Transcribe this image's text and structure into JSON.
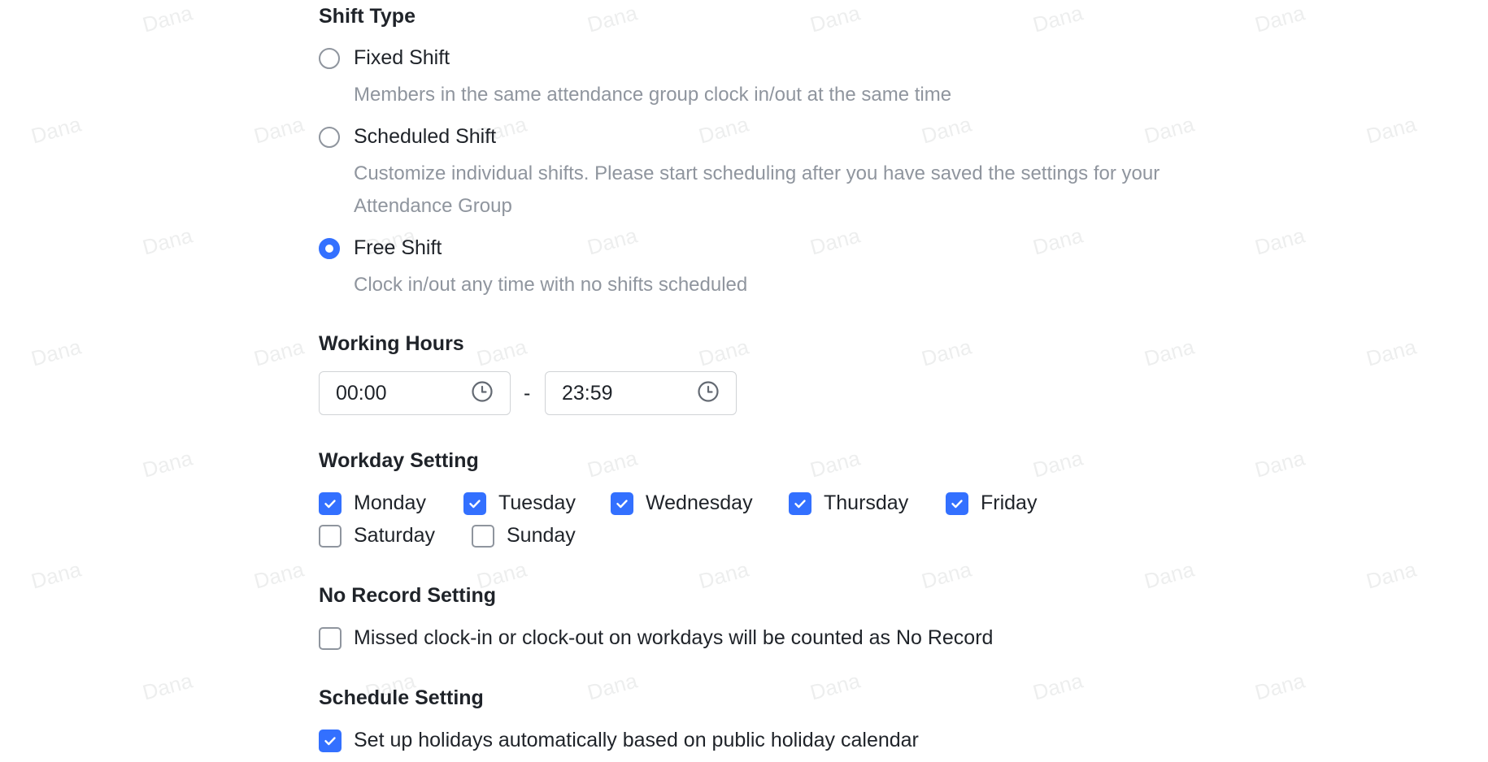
{
  "watermark": {
    "text": "Dana"
  },
  "shift_type": {
    "title": "Shift Type",
    "options": [
      {
        "label": "Fixed Shift",
        "description": "Members in the same attendance group clock in/out at the same time",
        "selected": false
      },
      {
        "label": "Scheduled Shift",
        "description": "Customize individual shifts. Please start scheduling after you have saved the settings for your Attendance Group",
        "selected": false
      },
      {
        "label": "Free Shift",
        "description": "Clock in/out any time with no shifts scheduled",
        "selected": true
      }
    ]
  },
  "working_hours": {
    "title": "Working Hours",
    "start": "00:00",
    "separator": "-",
    "end": "23:59",
    "icon": "clock-icon"
  },
  "workday_setting": {
    "title": "Workday Setting",
    "days": [
      {
        "label": "Monday",
        "checked": true
      },
      {
        "label": "Tuesday",
        "checked": true
      },
      {
        "label": "Wednesday",
        "checked": true
      },
      {
        "label": "Thursday",
        "checked": true
      },
      {
        "label": "Friday",
        "checked": true
      },
      {
        "label": "Saturday",
        "checked": false
      },
      {
        "label": "Sunday",
        "checked": false
      }
    ]
  },
  "no_record_setting": {
    "title": "No Record Setting",
    "option": {
      "label": "Missed clock-in or clock-out on workdays will be counted as No Record",
      "checked": false
    }
  },
  "schedule_setting": {
    "title": "Schedule Setting",
    "option": {
      "label": "Set up holidays automatically based on public holiday calendar",
      "checked": true
    }
  },
  "colors": {
    "accent": "#3370ff",
    "text": "#1f2329",
    "secondary_text": "#8f959e",
    "border": "#d0d3d6"
  }
}
